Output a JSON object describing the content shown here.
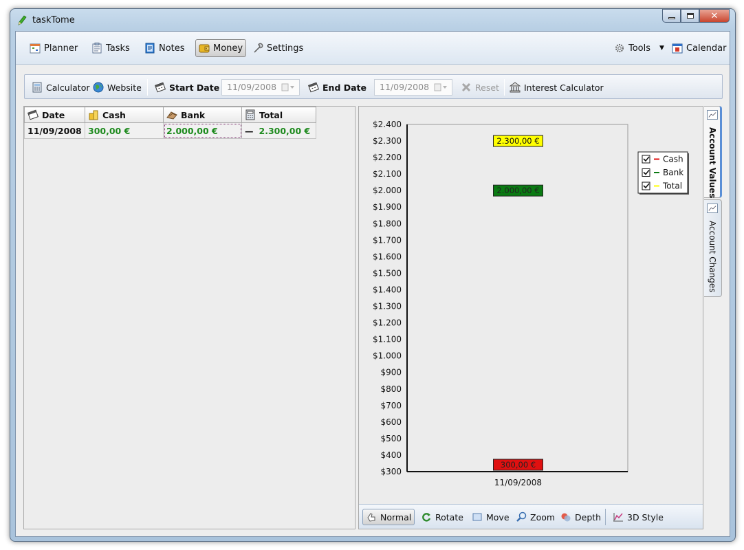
{
  "window": {
    "title": "taskTome",
    "controls": {
      "minimize": "minimize",
      "maximize": "maximize",
      "close": "✕"
    }
  },
  "menubar": {
    "items": [
      {
        "label": "Planner",
        "icon": "planner-icon"
      },
      {
        "label": "Tasks",
        "icon": "tasks-icon"
      },
      {
        "label": "Notes",
        "icon": "notes-icon"
      },
      {
        "label": "Money",
        "icon": "wallet-icon",
        "active": true
      },
      {
        "label": "Settings",
        "icon": "wrench-icon"
      }
    ],
    "right_items": [
      {
        "label": "Tools",
        "icon": "gear-icon"
      },
      {
        "label": "Calendar",
        "icon": "calendar-icon"
      }
    ]
  },
  "toolbar": {
    "calculator": "Calculator",
    "website": "Website",
    "start_date_label": "Start Date",
    "start_date_value": "11/09/2008",
    "end_date_label": "End Date",
    "end_date_value": "11/09/2008",
    "reset": "Reset",
    "interest_calculator": "Interest Calculator"
  },
  "table": {
    "columns": [
      "Date",
      "Cash",
      "Bank",
      "Total"
    ],
    "rows": [
      {
        "date": "11/09/2008",
        "cash": "300,00 €",
        "bank": "2.000,00 €",
        "total": "2.300,00 €"
      }
    ]
  },
  "side_tabs": {
    "account_values": "Account Values",
    "account_changes": "Account Changes"
  },
  "chart_toolbar": {
    "normal": "Normal",
    "rotate": "Rotate",
    "move": "Move",
    "zoom": "Zoom",
    "depth": "Depth",
    "style3d": "3D Style"
  },
  "chart_data": {
    "type": "scatter",
    "categories": [
      "11/09/2008"
    ],
    "ylim": [
      300,
      2400
    ],
    "y_ticks": [
      "$300",
      "$400",
      "$500",
      "$600",
      "$700",
      "$800",
      "$900",
      "$1.000",
      "$1.100",
      "$1.200",
      "$1.300",
      "$1.400",
      "$1.500",
      "$1.600",
      "$1.700",
      "$1.800",
      "$1.900",
      "$2.000",
      "$2.100",
      "$2.200",
      "$2.300",
      "$2.400"
    ],
    "grid": true,
    "legend_position": "top-right",
    "series": [
      {
        "name": "Cash",
        "color": "#e01010",
        "values": [
          300
        ],
        "label": "300,00 €"
      },
      {
        "name": "Bank",
        "color": "#0a7a12",
        "values": [
          2000
        ],
        "label": "2.000,00 €"
      },
      {
        "name": "Total",
        "color": "#ffff00",
        "values": [
          2300
        ],
        "label": "2.300,00 €"
      }
    ]
  }
}
